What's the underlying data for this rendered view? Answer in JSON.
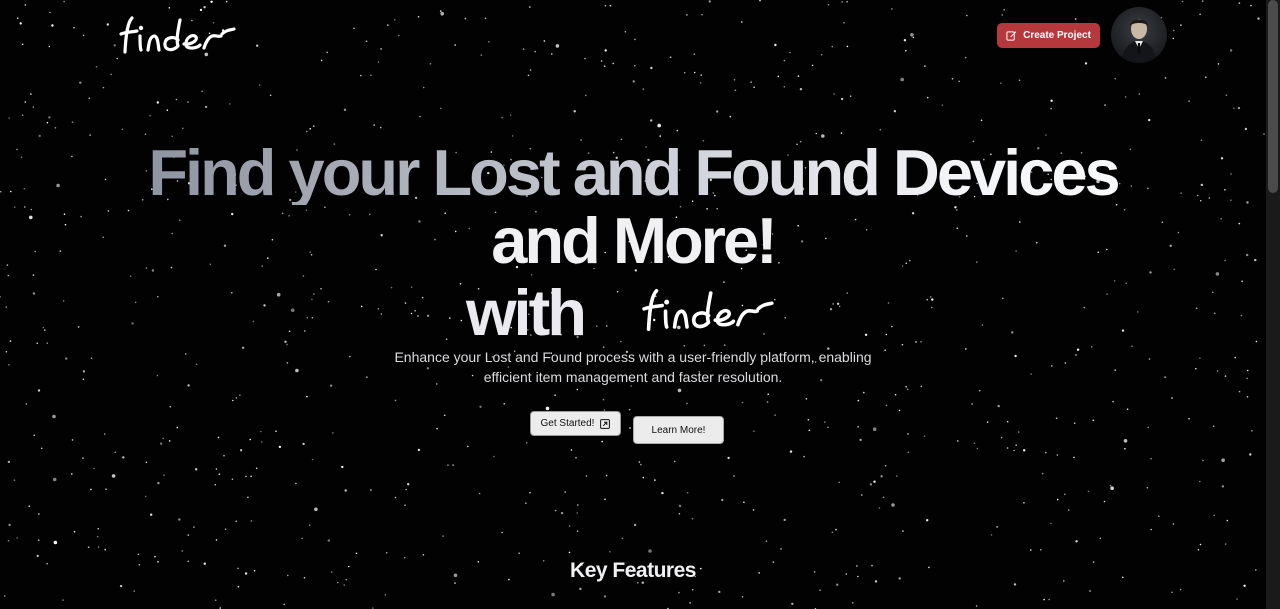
{
  "header": {
    "logo_text": "finder",
    "create_project_label": "Create Project",
    "create_icon": "edit-icon",
    "avatar_icon": "user-avatar"
  },
  "hero": {
    "title_line1": "Find your Lost and Found Devices",
    "title_line2": "and More!",
    "title_line3": "with",
    "logo_text": "finder",
    "subtitle_line1": "Enhance your Lost and Found process with a user-friendly platform, enabling",
    "subtitle_line2": "efficient item management and faster resolution.",
    "get_started_label": "Get Started!",
    "get_started_icon": "external-link-icon",
    "learn_more_label": "Learn More!"
  },
  "sections": {
    "key_features_title": "Key Features"
  },
  "colors": {
    "background": "#020202",
    "accent": "#b5383d",
    "button_bg": "#ececec"
  }
}
